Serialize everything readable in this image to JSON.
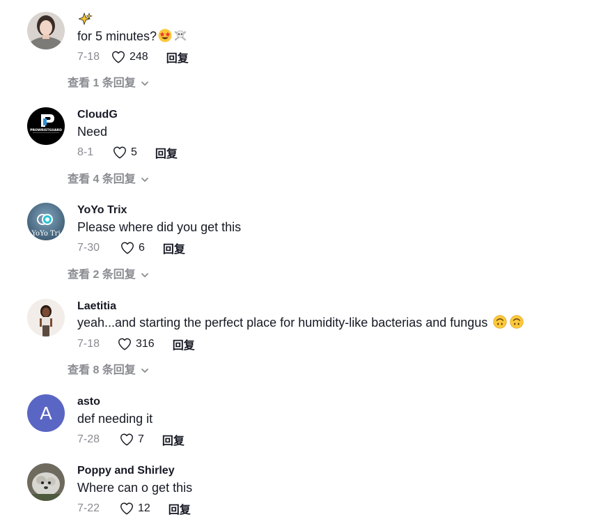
{
  "comments": [
    {
      "author": "",
      "author_emoji": "sparkles-emoji",
      "text": "for 5 minutes?",
      "text_emojis": [
        "star-struck-emoji",
        "skull-crossbones-emoji"
      ],
      "date": "7-18",
      "likes": "248",
      "reply_label": "回复",
      "view_replies": "查看 1 条回复",
      "avatar": "photo-avatar-girl"
    },
    {
      "author": "CloudG",
      "text": "Need",
      "date": "8-1",
      "likes": "5",
      "reply_label": "回复",
      "view_replies": "查看 4 条回复",
      "avatar": "logo-avatar-prowristguard",
      "avatar_text": "PROWRISTGUARD"
    },
    {
      "author": "YoYo Trix",
      "text": "Please where did you get this",
      "date": "7-30",
      "likes": "6",
      "reply_label": "回复",
      "view_replies": "查看 2 条回复",
      "avatar": "logo-avatar-yoyo",
      "avatar_text": "YoYo Tri"
    },
    {
      "author": "Laetitia",
      "text": "yeah...and starting the perfect place for humidity-like bacterias and fungus",
      "text_emojis": [
        "upside-down-face-emoji",
        "upside-down-face-emoji"
      ],
      "date": "7-18",
      "likes": "316",
      "reply_label": "回复",
      "view_replies": "查看 8 条回复",
      "avatar": "photo-avatar-woman"
    },
    {
      "author": "asto",
      "text": "def needing it",
      "date": "7-28",
      "likes": "7",
      "reply_label": "回复",
      "avatar": "letter-avatar",
      "avatar_letter": "A"
    },
    {
      "author": "Poppy and Shirley",
      "text": "Where can o get this",
      "date": "7-22",
      "likes": "12",
      "reply_label": "回复",
      "avatar": "photo-avatar-dog"
    }
  ],
  "colors": {
    "text_primary": "#161823",
    "text_secondary": "#8a8b91",
    "letter_avatar_bg": "#5a66c4"
  }
}
